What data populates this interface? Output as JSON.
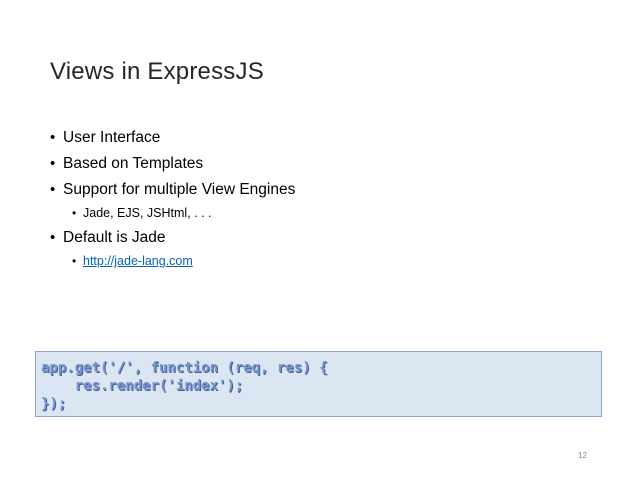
{
  "slide": {
    "title": "Views in ExpressJS",
    "bullets": [
      {
        "text": "User Interface"
      },
      {
        "text": "Based on Templates"
      },
      {
        "text": "Support for multiple View Engines",
        "sub": "Jade, EJS, JSHtml, . . ."
      },
      {
        "text": "Default is Jade",
        "sub_link": "http://jade-lang.com"
      }
    ],
    "bullet_glyph": "•",
    "code_lines": [
      "app.get('/', function (req, res) {",
      "    res.render('index');",
      "});"
    ],
    "page_number": "12",
    "colors": {
      "code_background": "#dce6f2",
      "code_border": "#8fa8cf",
      "code_text": "#7895cc",
      "link": "#0563c1"
    }
  }
}
